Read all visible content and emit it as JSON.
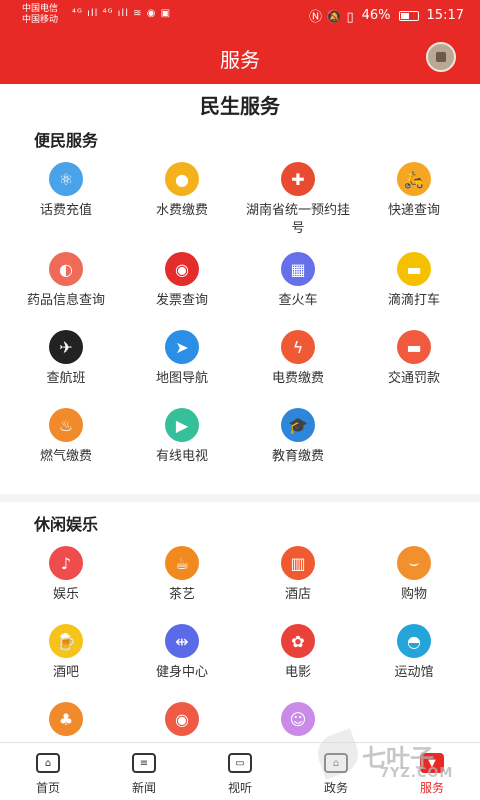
{
  "status_bar": {
    "carrier1": "中国电信",
    "carrier2": "中国移动",
    "left_icons": "⁴ᴳ ıll ⁴ᴳ ıll ≋ ◉ ▣",
    "right_icons": "Ⓝ 🔕 ▯",
    "battery": "46%",
    "time": "15:17"
  },
  "header": {
    "title": "服务"
  },
  "page_title": "民生服务",
  "sections": [
    {
      "title": "便民服务",
      "items": [
        {
          "label": "话费充值",
          "icon": "atom-icon",
          "color": "#4aa3e8",
          "glyph": "⚛"
        },
        {
          "label": "水费缴费",
          "icon": "water-drop-icon",
          "color": "#f5b11b",
          "glyph": "●"
        },
        {
          "label": "湖南省统一预约挂号",
          "icon": "medical-laptop-icon",
          "color": "#e84b2f",
          "glyph": "✚"
        },
        {
          "label": "快递查询",
          "icon": "delivery-scooter-icon",
          "color": "#f5a623",
          "glyph": "🛵"
        },
        {
          "label": "药品信息查询",
          "icon": "pill-icon",
          "color": "#f06a58",
          "glyph": "◐"
        },
        {
          "label": "发票查询",
          "icon": "invoice-seal-icon",
          "color": "#e32d2d",
          "glyph": "◉"
        },
        {
          "label": "查火车",
          "icon": "train-icon",
          "color": "#6570e9",
          "glyph": "▦"
        },
        {
          "label": "滴滴打车",
          "icon": "taxi-icon",
          "color": "#f5c000",
          "glyph": "▬"
        },
        {
          "label": "查航班",
          "icon": "airplane-globe-icon",
          "color": "#222222",
          "glyph": "✈"
        },
        {
          "label": "地图导航",
          "icon": "navigation-arrow-icon",
          "color": "#2b8fe6",
          "glyph": "➤"
        },
        {
          "label": "电费缴费",
          "icon": "lightning-icon",
          "color": "#ef5a35",
          "glyph": "ϟ"
        },
        {
          "label": "交通罚款",
          "icon": "no-entry-icon",
          "color": "#f05b3f",
          "glyph": "▬"
        },
        {
          "label": "燃气缴费",
          "icon": "flame-icon",
          "color": "#f08a2b",
          "glyph": "♨"
        },
        {
          "label": "有线电视",
          "icon": "tv-play-icon",
          "color": "#36bf9b",
          "glyph": "▶"
        },
        {
          "label": "教育缴费",
          "icon": "graduation-cap-icon",
          "color": "#2e86d8",
          "glyph": "🎓"
        }
      ]
    },
    {
      "title": "休闲娱乐",
      "items": [
        {
          "label": "娱乐",
          "icon": "music-note-icon",
          "color": "#ef4d4d",
          "glyph": "♪"
        },
        {
          "label": "茶艺",
          "icon": "tea-cup-icon",
          "color": "#f08a1e",
          "glyph": "☕"
        },
        {
          "label": "酒店",
          "icon": "hotel-building-icon",
          "color": "#ef5a30",
          "glyph": "▥"
        },
        {
          "label": "购物",
          "icon": "shopping-bag-icon",
          "color": "#f3902e",
          "glyph": "⌣"
        },
        {
          "label": "酒吧",
          "icon": "beer-icon",
          "color": "#f5c31a",
          "glyph": "🍺"
        },
        {
          "label": "健身中心",
          "icon": "dumbbell-icon",
          "color": "#5b6be8",
          "glyph": "⇹"
        },
        {
          "label": "电影",
          "icon": "film-reel-icon",
          "color": "#e8423a",
          "glyph": "✿"
        },
        {
          "label": "运动馆",
          "icon": "stadium-icon",
          "color": "#24a4d8",
          "glyph": "◓"
        },
        {
          "label": "",
          "icon": "tree-icon",
          "color": "#f08a2b",
          "glyph": "♣"
        },
        {
          "label": "",
          "icon": "camera-icon",
          "color": "#ef5a45",
          "glyph": "◉"
        },
        {
          "label": "",
          "icon": "beauty-woman-icon",
          "color": "#c98ae8",
          "glyph": "☺"
        }
      ]
    }
  ],
  "bottom_nav": [
    {
      "label": "首页",
      "icon": "home-icon",
      "glyph": "⌂"
    },
    {
      "label": "新闻",
      "icon": "news-icon",
      "glyph": "≡"
    },
    {
      "label": "视听",
      "icon": "video-camera-icon",
      "glyph": "▭"
    },
    {
      "label": "政务",
      "icon": "government-building-icon",
      "glyph": "⌂"
    },
    {
      "label": "服务",
      "icon": "service-bookmark-icon",
      "glyph": "▼",
      "active": true
    }
  ],
  "watermark": {
    "brand": "七叶子",
    "subtext": "7YZ.COM"
  }
}
